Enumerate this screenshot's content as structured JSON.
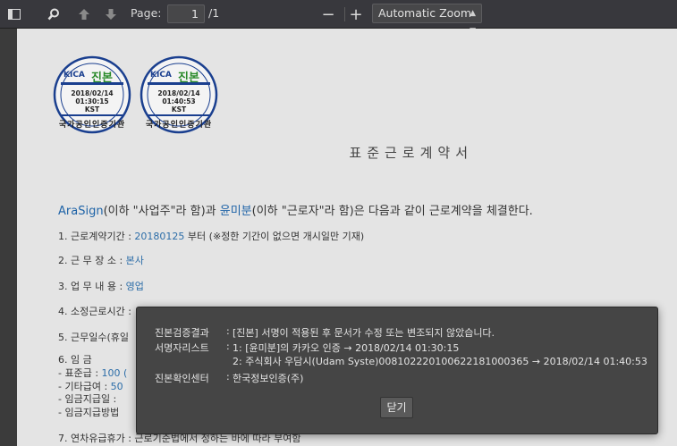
{
  "toolbar": {
    "page_label": "Page:",
    "page_value": "1",
    "page_total": "/1",
    "zoom_minus": "−",
    "zoom_plus": "+",
    "zoom_value": "Automatic Zoom"
  },
  "document": {
    "seals": [
      {
        "org": "KICA",
        "title": "진본",
        "date": "2018/02/14",
        "time": "01:30:15",
        "tz": "KST",
        "ring": "국가공인인증기관"
      },
      {
        "org": "KICA",
        "title": "진본",
        "date": "2018/02/14",
        "time": "01:40:53",
        "tz": "KST",
        "ring": "국가공인인증기관"
      }
    ],
    "title": "표준근로계약서",
    "intro": {
      "employer": "AraSign",
      "part1": "(이하 \"사업주\"라 함)과 ",
      "employee": "윤미분",
      "part2": "(이하 \"근로자\"라 함)은 다음과 같이 근로계약을 체결한다."
    },
    "lines": [
      {
        "label": "1. 근로계약기간 : ",
        "value": "20180125",
        "rest": " 부터   (※정한 기간이 없으면 개시일만 기재)"
      },
      {
        "label": "2. 근  무  장  소 : ",
        "value": "본사",
        "rest": ""
      },
      {
        "label": "3. 업  무  내  용 : ",
        "value": "영업",
        "rest": ""
      },
      {
        "label": "4. 소정근로시간 : ",
        "value": "",
        "rest": ""
      },
      {
        "label": "5. 근무일수(휴일",
        "value": "",
        "rest": ""
      },
      {
        "label": "6. 임  금",
        "value": "",
        "rest": ""
      },
      {
        "label": "  - 표준급 : ",
        "value": "100 (",
        "rest": ""
      },
      {
        "label": "  - 기타급여 : ",
        "value": "50",
        "rest": ""
      },
      {
        "label": "  - 임금지급일 :",
        "value": "",
        "rest": ""
      },
      {
        "label": "  - 임금지급방법",
        "value": "",
        "rest": ""
      },
      {
        "label": "7. 연차유급휴가 : ",
        "value": "",
        "rest": "근로기준법에서 정하는 바에 따라 부여함"
      }
    ]
  },
  "dialog": {
    "rows": [
      {
        "label": "진본검증결과",
        "value": "[진본] 서명이 적용된 후 문서가 수정 또는 변조되지 않았습니다."
      },
      {
        "label": "서명자리스트",
        "value": "1: [윤미분]의 카카오 인증 → 2018/02/14 01:30:15"
      },
      {
        "label": "",
        "value": "2: 주식회사 우담시(Udam Syste)0081022201006221810003​65 → 2018/02/14 01:40:53"
      },
      {
        "label": "진본확인센터",
        "value": "한국정보인증(주)"
      }
    ],
    "colon": ":",
    "close_label": "닫기"
  },
  "colors": {
    "seal_blue": "#1a3f8f",
    "seal_green": "#2a8a2a",
    "link_blue": "#1e63a7"
  }
}
